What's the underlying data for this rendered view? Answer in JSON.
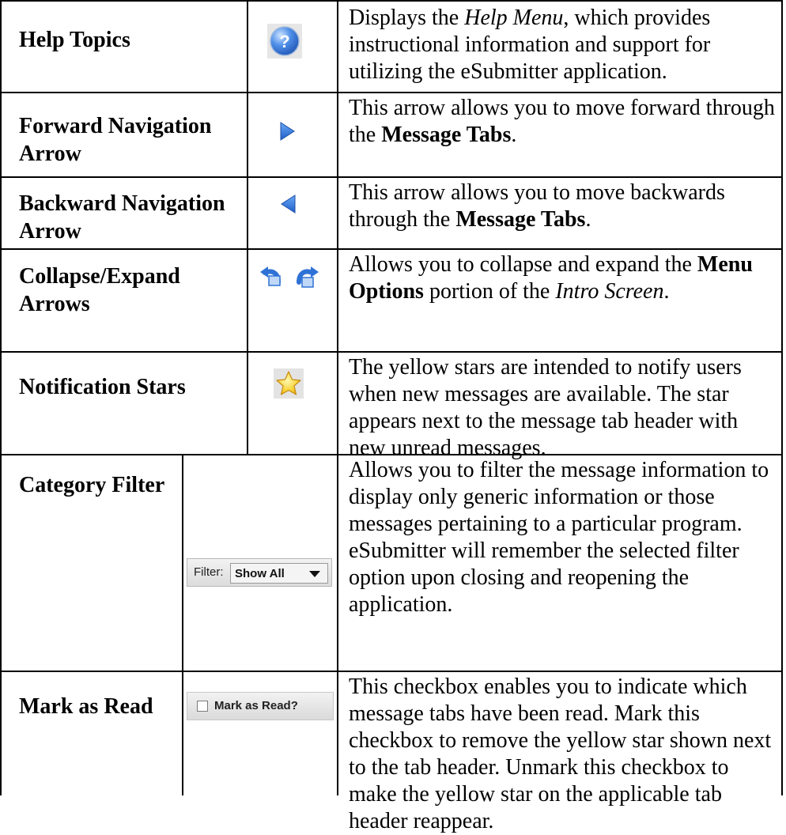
{
  "rows": [
    {
      "term": "Help Topics",
      "icon": "help-question-icon",
      "desc": [
        "Displays the ",
        {
          "i": "Help Menu"
        },
        ", which provides instructional information and support for utilizing the eSubmitter application."
      ]
    },
    {
      "term": "Forward Navigation Arrow",
      "icon": "forward-arrow-icon",
      "desc": [
        "This arrow allows you to move forward through the ",
        {
          "b": "Message Tabs"
        },
        "."
      ]
    },
    {
      "term": "Backward Navigation Arrow",
      "icon": "backward-arrow-icon",
      "desc": [
        "This arrow allows you to move backwards through the ",
        {
          "b": "Message Tabs"
        },
        "."
      ]
    },
    {
      "term": "Collapse/Expand Arrows",
      "icon": "collapse-expand-arrows-icon",
      "desc": [
        "Allows you to collapse and expand the ",
        {
          "b": "Menu Options"
        },
        " portion of the ",
        {
          "i": "Intro Screen"
        },
        "."
      ]
    },
    {
      "term": "Notification Stars",
      "icon": "star-icon",
      "desc": [
        "The yellow stars are intended to notify users when new messages are available. The star appears next to the message tab header with new unread messages."
      ]
    },
    {
      "term": "Category Filter",
      "widget": {
        "label": "Filter:",
        "value": "Show All"
      },
      "desc": [
        "Allows you to filter the message information to display only generic information or those messages pertaining to a particular program.  eSubmitter will remember the selected filter option upon closing and reopening the application."
      ]
    },
    {
      "term": "Mark as Read",
      "widget": {
        "label": "Mark as Read?"
      },
      "desc": [
        "This checkbox enables you to indicate which message tabs have been read.  Mark this checkbox to remove the yellow star shown next to the tab header.  Unmark this checkbox to make the yellow star on the applicable tab header reappear."
      ]
    }
  ],
  "colors": {
    "icon_blue": "#2d6fd8",
    "star_yellow": "#f7d43a"
  }
}
